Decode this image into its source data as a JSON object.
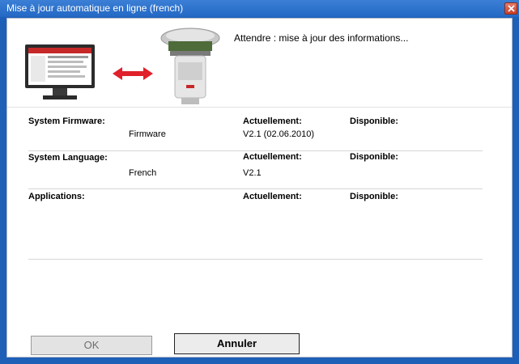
{
  "window": {
    "title": "Mise à jour automatique en ligne (french)"
  },
  "status": {
    "text": "Attendre : mise à jour des informations..."
  },
  "columns": {
    "current_header": "Actuellement:",
    "available_header": "Disponible:"
  },
  "sections": [
    {
      "label": "System Firmware:",
      "item": "Firmware",
      "current": "V2.1 (02.06.2010)",
      "available": ""
    },
    {
      "label": "System Language:",
      "item": "French",
      "current": "V2.1",
      "available": ""
    },
    {
      "label": "Applications:",
      "item": "",
      "current": "",
      "available": ""
    }
  ],
  "buttons": {
    "ok_label": "OK",
    "cancel_label": "Annuler"
  },
  "icons": {
    "computer": "computer-monitor-icon",
    "transfer": "double-arrow-icon",
    "device": "gnss-receiver-icon",
    "close": "close-icon"
  },
  "colors": {
    "titlebar": "#2368c4",
    "arrow": "#e0202a",
    "close": "#c6402b"
  }
}
